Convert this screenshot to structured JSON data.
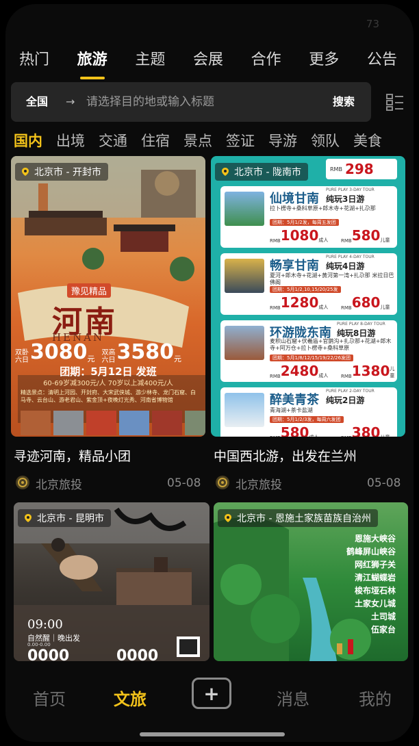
{
  "status": {
    "corner_number": "73"
  },
  "top_tabs": [
    {
      "label": "热门",
      "active": false
    },
    {
      "label": "旅游",
      "active": true
    },
    {
      "label": "主题",
      "active": false
    },
    {
      "label": "会展",
      "active": false
    },
    {
      "label": "合作",
      "active": false
    },
    {
      "label": "更多",
      "active": false
    },
    {
      "label": "公告",
      "active": false
    }
  ],
  "search": {
    "region": "全国",
    "arrow": "→",
    "placeholder": "请选择目的地或输入标题",
    "button": "搜索",
    "layout_icon": "grid-list-icon"
  },
  "categories": [
    {
      "label": "国内",
      "active": true
    },
    {
      "label": "出境",
      "active": false
    },
    {
      "label": "交通",
      "active": false
    },
    {
      "label": "住宿",
      "active": false
    },
    {
      "label": "景点",
      "active": false
    },
    {
      "label": "签证",
      "active": false
    },
    {
      "label": "导游",
      "active": false
    },
    {
      "label": "领队",
      "active": false
    },
    {
      "label": "美食",
      "active": false
    }
  ],
  "cards": [
    {
      "location": "北京市 - 开封市",
      "title": "寻迹河南，精品小团",
      "author": "北京旅投",
      "date": "05-08",
      "poster": {
        "headline": "河南",
        "headline_en": "HENAN",
        "badge": "豫见精品",
        "price_a_label": "双卧 六日",
        "price_a": "3080",
        "price_b_label": "双高 六日",
        "price_b": "3580",
        "unit": "元",
        "depart": "团期：5月12日 发班",
        "discount": "60-69岁减300元/人 70岁以上减400元/人",
        "highlights": "精选景点：清明上河园、开封府、大宋武侠城、游少林寺、龙门石窟、白马寺、云台山、游老君山、紫金顶+夜晚灯光秀、河南省博物馆"
      }
    },
    {
      "location": "北京市 - 陇南市",
      "title": "中国西北游，出发在兰州",
      "author": "北京旅投",
      "date": "05-08",
      "poster": {
        "top_price": "298",
        "rmb": "RMB",
        "tours": [
          {
            "name": "仙境甘南",
            "tag": "纯玩3日游",
            "en": "PURE PLAY 3-DAY TOUR",
            "route": "拉卜楞寺+桑科草原+郎木寺+花湖+扎尕那",
            "dates": "团期：5月1/2发，每周五发团",
            "adult_price": "1080",
            "child_price": "580",
            "adult_label": "成人",
            "child_label": "儿童"
          },
          {
            "name": "畅享甘南",
            "tag": "纯玩4日游",
            "en": "PURE PLAY 4-DAY TOUR",
            "route": "夏河+郎木寺+花湖+黄河第一湾+扎尕那 米拉日巴佛阁",
            "dates": "团期：5月1/2,10,15/20/25发",
            "adult_price": "1280",
            "child_price": "680",
            "adult_label": "成人",
            "child_label": "儿童"
          },
          {
            "name": "环游陇东南",
            "tag": "纯玩8日游",
            "en": "PURE PLAY 8-DAY TOUR",
            "route": "麦积山石窟+伏羲庙+官鹅沟+扎尕那+花湖+郎木寺+阿万仓+拉卜楞寺+桑科草原",
            "dates": "团期：5月1/8/12/15/19/22/26发团",
            "adult_price": "2480",
            "child_price": "1380",
            "adult_label": "成人",
            "child_label": "儿童"
          },
          {
            "name": "醉美青茶",
            "tag": "纯玩2日游",
            "en": "PURE PLAY 2-DAY TOUR",
            "route": "青海湖+茶卡盐湖",
            "dates": "团期：5月1/2/3发，每周六发团",
            "adult_price": "580",
            "child_price": "380",
            "adult_label": "成人",
            "child_label": "儿童"
          }
        ]
      }
    },
    {
      "location": "北京市 - 昆明市",
      "poster": {
        "time": "09:00",
        "caption": "自然醒｜晚出发",
        "price_a": "0000",
        "price_b": "0000",
        "small": "0.00-0.00"
      }
    },
    {
      "location": "北京市 - 恩施土家族苗族自治州",
      "poster": {
        "spots": [
          "恩施大峡谷",
          "鹤峰屏山峡谷",
          "网红狮子关",
          "清江蝴蝶岩",
          "梭布垭石林",
          "土家女儿城",
          "土司城",
          "伍家台"
        ]
      }
    }
  ],
  "bottom_nav": [
    {
      "label": "首页",
      "active": false
    },
    {
      "label": "文旅",
      "active": true
    },
    {
      "label": "+",
      "active": false
    },
    {
      "label": "消息",
      "active": false
    },
    {
      "label": "我的",
      "active": false
    }
  ],
  "colors": {
    "accent": "#f2c21a",
    "background": "#0b0b0b",
    "search_bg": "#262626",
    "henan_orange": "#d9682a",
    "gansu_teal": "#1fb0a8",
    "gansu_red": "#c9161d",
    "enshi_green": "#2f8a3a"
  }
}
